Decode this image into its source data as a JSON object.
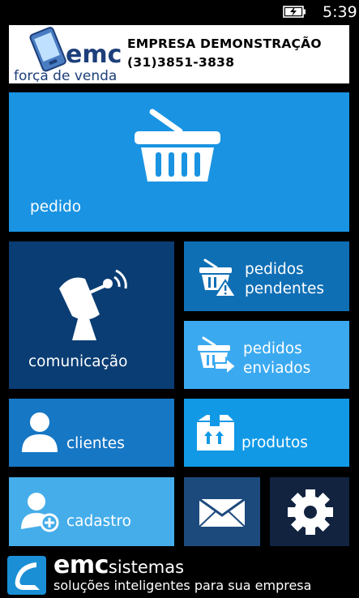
{
  "status_bar": {
    "time": "5:39",
    "battery_icon": "battery-charging-icon"
  },
  "header": {
    "logo_brand": "emc",
    "logo_subtitle": "força de venda",
    "company_name": "EMPRESA DEMONSTRAÇÃO",
    "phone": "(31)3851-3838"
  },
  "tiles": {
    "pedido": {
      "label": "pedido",
      "icon": "shopping-basket-icon"
    },
    "comunicacao": {
      "label": "comunicação",
      "icon": "satellite-dish-icon"
    },
    "pedidos_pendentes": {
      "label_line1": "pedidos",
      "label_line2": "pendentes",
      "icon": "basket-warning-icon"
    },
    "pedidos_enviados": {
      "label_line1": "pedidos",
      "label_line2": "enviados",
      "icon": "basket-send-icon"
    },
    "clientes": {
      "label": "clientes",
      "icon": "user-icon"
    },
    "produtos": {
      "label": "produtos",
      "icon": "box-icon"
    },
    "cadastro": {
      "label": "cadastro",
      "icon": "add-user-icon"
    },
    "mensagens": {
      "icon": "envelope-icon"
    },
    "configuracoes": {
      "icon": "gear-icon"
    }
  },
  "footer": {
    "brand_bold": "emc",
    "brand_light": "sistemas",
    "tagline": "soluções inteligentes para sua empresa",
    "logo_icon": "emc-logo-icon"
  },
  "colors": {
    "background": "#000000",
    "pedido": "#1993e2",
    "comunicacao": "#0a3d73",
    "pedidos_pendentes": "#0f6fb5",
    "pedidos_enviados": "#3aa9f0",
    "clientes": "#1677c4",
    "produtos": "#1199e6",
    "cadastro": "#45ade9",
    "mensagens": "#1d4a7d",
    "configuracoes": "#11233f"
  }
}
